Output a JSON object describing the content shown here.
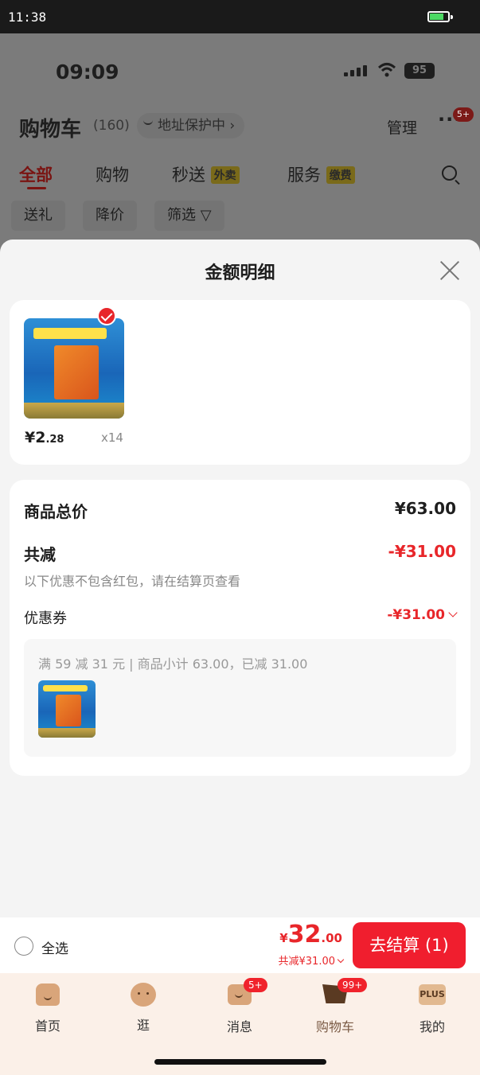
{
  "system_bar": {
    "time": "11:38",
    "battery_level": 0.7
  },
  "background_page": {
    "status_time": "09:09",
    "battery": "95",
    "title": "购物车",
    "count": "(160)",
    "address_protect": "地址保护中 ›",
    "manage": "管理",
    "more": "···",
    "more_badge": "5+",
    "tabs": [
      {
        "label": "全部"
      },
      {
        "label": "购物"
      },
      {
        "label": "秒送",
        "tag": "外卖"
      },
      {
        "label": "服务",
        "tag": "缴费"
      }
    ],
    "chips": [
      "送礼",
      "降价",
      "筛选 ▽"
    ]
  },
  "sheet": {
    "title": "金额明细",
    "product": {
      "price_int": "¥2",
      "price_dec": ".28",
      "qty": "x14"
    },
    "summary": {
      "total_label": "商品总价",
      "total_value": "¥63.00",
      "discount_label": "共减",
      "discount_value": "-¥31.00",
      "note": "以下优惠不包含红包，请在结算页查看",
      "coupon_label": "优惠券",
      "coupon_value": "-¥31.00",
      "coupon_desc": "满 59 减 31 元 | 商品小计 63.00，已减 31.00"
    }
  },
  "checkout": {
    "select_all": "全选",
    "currency": "¥",
    "total_int": "32",
    "total_dec": ".00",
    "saved": "共减¥31.00",
    "button": "去结算 (1)"
  },
  "tabbar": {
    "items": [
      {
        "label": "首页",
        "icon": "home-icon"
      },
      {
        "label": "逛",
        "icon": "face-icon"
      },
      {
        "label": "消息",
        "icon": "message-icon",
        "badge": "5+"
      },
      {
        "label": "购物车",
        "icon": "cart-icon",
        "badge": "99+"
      },
      {
        "label": "我的",
        "icon": "plus-icon",
        "icon_text": "PLUS"
      }
    ]
  },
  "colors": {
    "accent": "#f01e2e",
    "price_red": "#e8262a"
  }
}
